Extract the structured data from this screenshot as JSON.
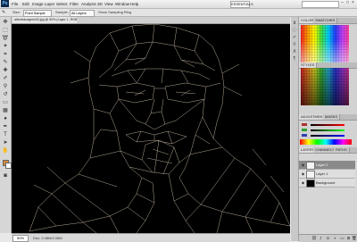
{
  "menubar": {
    "logo": "Ps",
    "items": [
      "File",
      "Edit",
      "Image",
      "Layer",
      "Select",
      "Filter",
      "Analysis",
      "3D",
      "View",
      "Window",
      "Help"
    ],
    "workspace_label": "ESSENTIALS",
    "window_controls": [
      "–",
      "□",
      "×"
    ]
  },
  "optionsbar": {
    "items": [
      "Size:",
      "Point Sample",
      "Sample:",
      "All Layers",
      "Show Sampling Ring"
    ]
  },
  "document": {
    "tab_title": "albertsburgerix03.jpg @ 50% (Layer 1, RGB/8) *",
    "zoom": "50%",
    "info": "Doc: 2.08M/2.08M"
  },
  "panels": {
    "color_tabs": [
      "COLOR",
      "SWATCHES"
    ],
    "styles_tabs": [
      "STYLES"
    ],
    "adjust_tabs": [
      "ADJUSTMENTS",
      "MASKS"
    ],
    "layers_tabs": [
      "LAYERS",
      "CHANNELS",
      "PATHS"
    ],
    "layers": [
      {
        "name": "Layer 2",
        "visible": true,
        "selected": true
      },
      {
        "name": "Layer 1",
        "visible": true,
        "selected": false
      },
      {
        "name": "Background",
        "visible": true,
        "selected": false
      }
    ]
  },
  "colors": {
    "foreground": "#d98a3a",
    "background": "#ffffff",
    "canvas": "#000000",
    "line": "#d8c8b0"
  }
}
